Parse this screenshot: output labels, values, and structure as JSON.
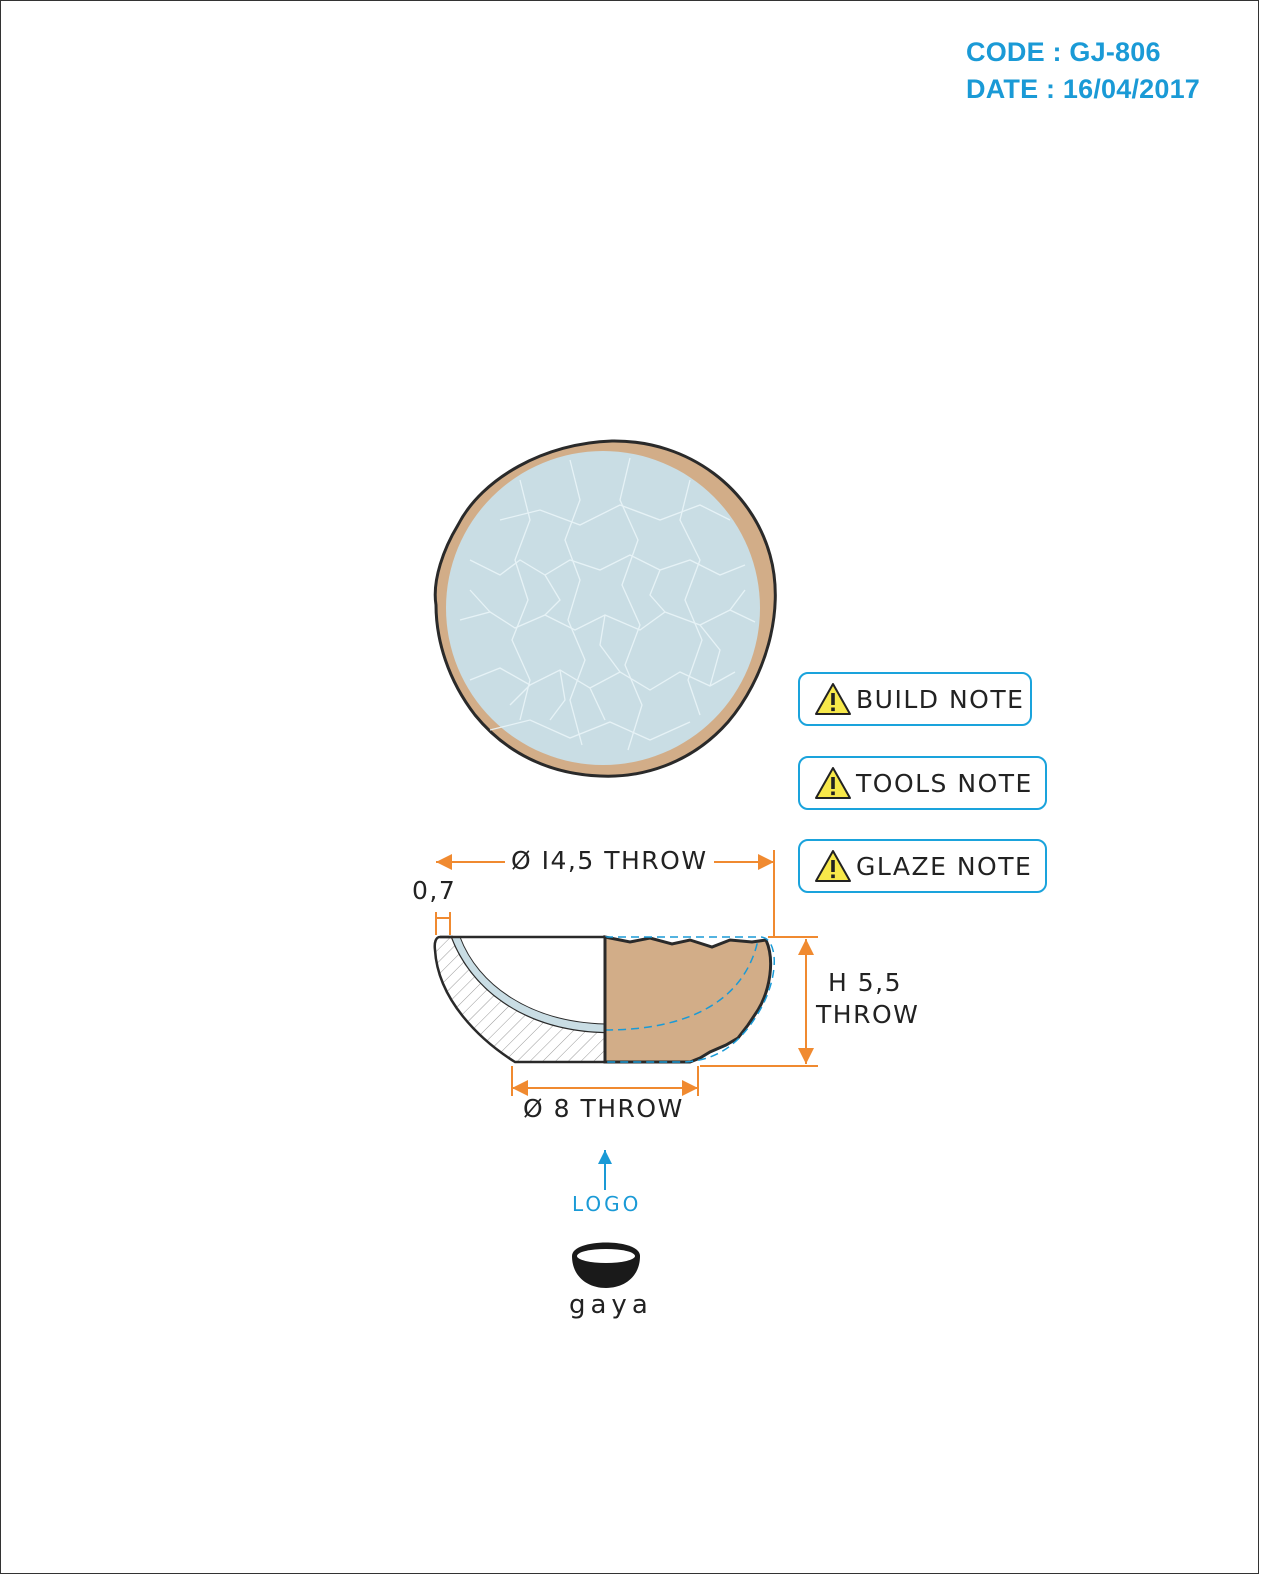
{
  "header": {
    "code": "CODE : GJ-806",
    "date": "DATE : 16/04/2017"
  },
  "notes": [
    {
      "label": "BUILD NOTE",
      "icon": "warning-icon"
    },
    {
      "label": "TOOLS NOTE",
      "icon": "warning-icon"
    },
    {
      "label": "GLAZE NOTE",
      "icon": "warning-icon"
    }
  ],
  "dimensions": {
    "rim_diameter": "Ø I4,5 THROW",
    "wall_thickness": "0,7",
    "height_line1": "H 5,5",
    "height_line2": "THROW",
    "foot_diameter": "Ø 8 THROW"
  },
  "logo": {
    "label": "LOGO",
    "brand": "gaya"
  },
  "colors": {
    "accent_blue": "#1a9ad6",
    "dimension_orange": "#f08a30",
    "clay": "#d2ad88",
    "glaze": "#c9dde4",
    "warning_yellow": "#f7e84a"
  }
}
